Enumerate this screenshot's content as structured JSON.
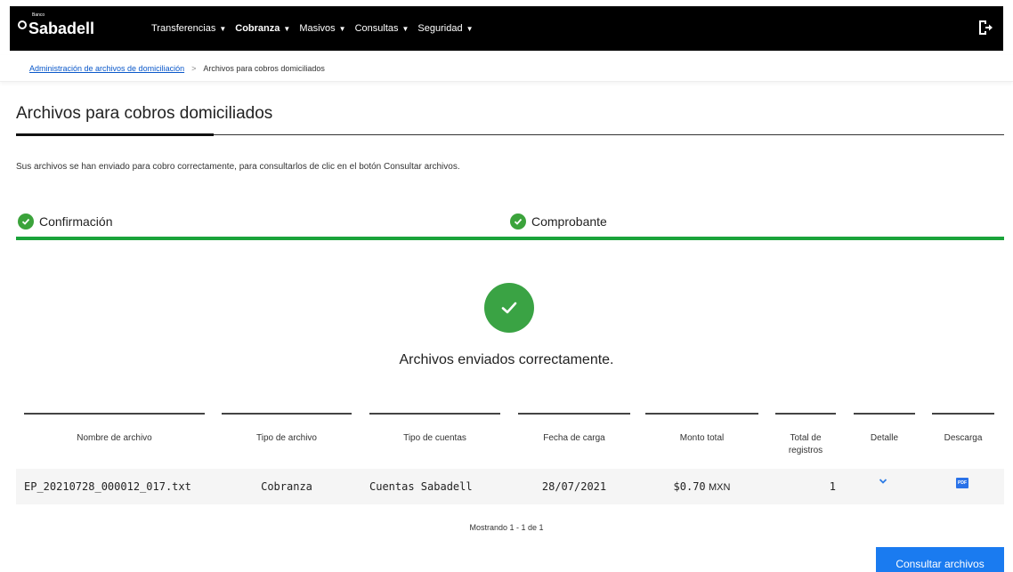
{
  "brand": {
    "small": "Banco",
    "name": "Sabadell"
  },
  "nav": [
    {
      "label": "Transferencias",
      "active": false
    },
    {
      "label": "Cobranza",
      "active": true
    },
    {
      "label": "Masivos",
      "active": false
    },
    {
      "label": "Consultas",
      "active": false
    },
    {
      "label": "Seguridad",
      "active": false
    }
  ],
  "breadcrumb": {
    "link": "Administración de archivos de domiciliación",
    "separator": ">",
    "current": "Archivos para cobros domiciliados"
  },
  "page": {
    "title": "Archivos para cobros domiciliados",
    "info": "Sus archivos se han enviado para cobro correctamente, para consultarlos de clic en el botón Consultar archivos."
  },
  "steps": [
    {
      "label": "Confirmación"
    },
    {
      "label": "Comprobante"
    }
  ],
  "success": {
    "message": "Archivos enviados correctamente."
  },
  "table": {
    "headers": {
      "nombre": "Nombre de archivo",
      "tipo_archivo": "Tipo de archivo",
      "tipo_cuentas": "Tipo de cuentas",
      "fecha": "Fecha de carga",
      "monto": "Monto total",
      "total_1": "Total de",
      "total_2": "registros",
      "detalle": "Detalle",
      "descarga": "Descarga"
    },
    "rows": [
      {
        "nombre": "EP_20210728_000012_017.txt",
        "tipo_archivo": "Cobranza",
        "tipo_cuentas": "Cuentas Sabadell",
        "fecha": "28/07/2021",
        "monto": "$0.70",
        "moneda": "MXN",
        "total": "1",
        "descarga_label": "PDF"
      }
    ]
  },
  "pagination": {
    "text": "Mostrando 1 - 1 de 1"
  },
  "actions": {
    "consultar": "Consultar archivos"
  },
  "colors": {
    "accent": "#1a7bf0",
    "success": "#3aa344",
    "header_bg": "#000000"
  },
  "icons": {
    "logout": "logout-icon",
    "check": "check-circle-icon",
    "detail": "chevron-down-icon",
    "pdf": "pdf-icon"
  }
}
